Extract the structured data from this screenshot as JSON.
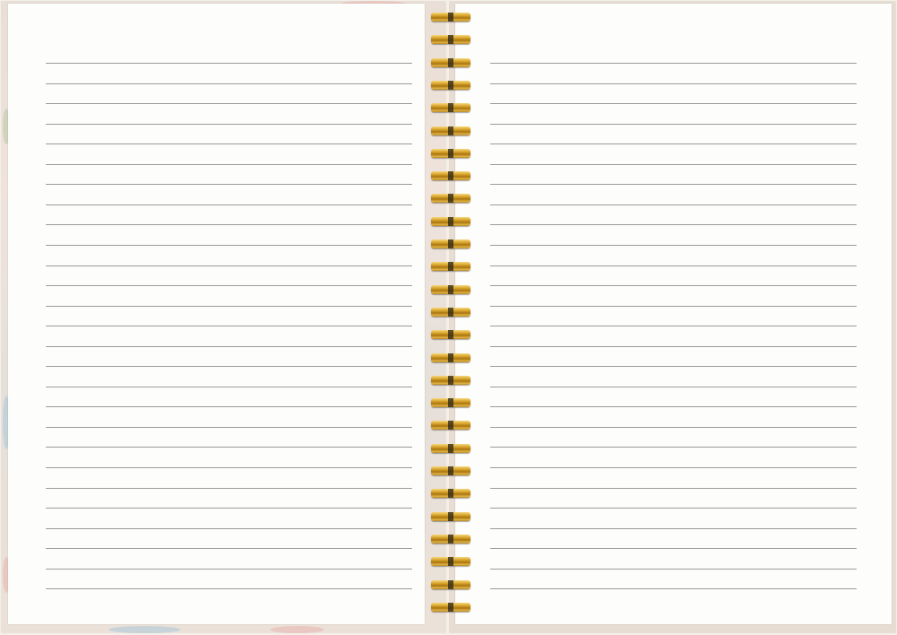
{
  "image": {
    "subject": "open-spiral-notebook",
    "binding": {
      "type": "twin-wire",
      "color": "#d4a52c",
      "coil_count": 27
    },
    "pages": {
      "left": {
        "type": "lined",
        "line_count": 27,
        "line_color": "#9b9b9b"
      },
      "right": {
        "type": "lined",
        "line_count": 27,
        "line_color": "#9b9b9b"
      }
    },
    "cover": {
      "pattern": "floral",
      "colors": [
        "#e9dfd6",
        "#a9c8d8",
        "#e7b5b0",
        "#7a8b55"
      ]
    },
    "paper_color": "#fdfdfb"
  }
}
